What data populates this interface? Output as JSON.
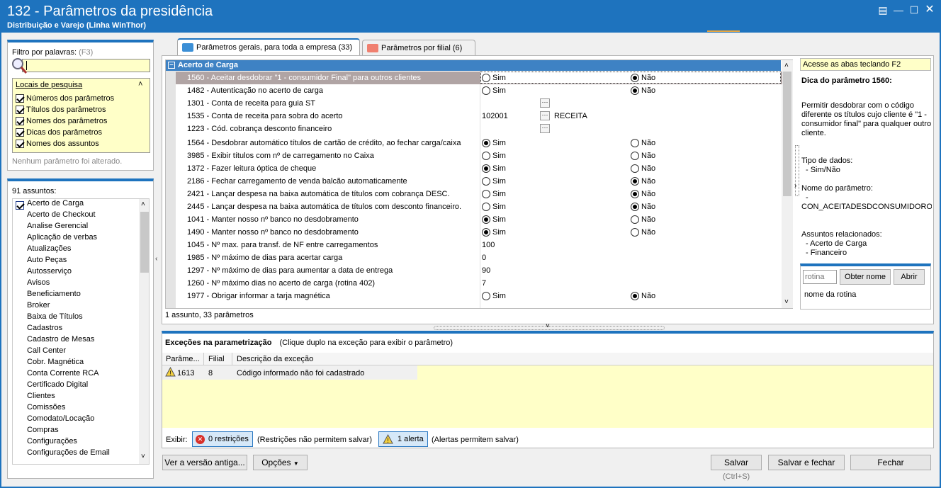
{
  "window": {
    "title": "132 - Parâmetros da presidência",
    "subtitle": "Distribuição e Varejo (Linha WinThor)"
  },
  "filter": {
    "label": "Filtro por palavras:",
    "shortcut": "(F3)",
    "search_value": "",
    "locais_title": "Locais de pesquisa",
    "locais": [
      "Números dos parâmetros",
      "Títulos dos parâmetros",
      "Nomes dos parâmetros",
      "Dicas dos parâmetros",
      "Nomes dos assuntos"
    ],
    "status": "Nenhum parâmetro foi alterado."
  },
  "subjects": {
    "count_label": "91 assuntos:",
    "items": [
      "Acerto de Carga",
      "Acerto de Checkout",
      "Analise Gerencial",
      "Aplicação de verbas",
      "Atualizações",
      "Auto Peças",
      "Autosserviço",
      "Avisos",
      "Beneficiamento",
      "Broker",
      "Baixa de Títulos",
      "Cadastros",
      "Cadastro de Mesas",
      "Call Center",
      "Cobr. Magnética",
      "Conta Corrente RCA",
      "Certificado Digital",
      "Clientes",
      "Comissões",
      "Comodato/Locação",
      "Compras",
      "Configurações",
      "Configurações de Email"
    ]
  },
  "tabs": [
    {
      "label": "Parâmetros gerais, para toda a empresa",
      "count": "(33)"
    },
    {
      "label": "Parâmetros por filial",
      "count": "(6)"
    }
  ],
  "grid": {
    "group_title": "Acerto de Carga",
    "rows": [
      {
        "label": "1560 - Aceitar desdobrar \"1 - consumidor Final\" para outros clientes",
        "kind": "radio",
        "opt1": "Sim",
        "opt2": "Não",
        "sel": 2
      },
      {
        "label": "1482 - Autenticação no acerto de carga",
        "kind": "radio",
        "opt1": "Sim",
        "opt2": "Não",
        "sel": 2
      },
      {
        "label": "1301 - Conta de receita para guia ST",
        "kind": "lookup",
        "value": "",
        "extra": ""
      },
      {
        "label": "1535 - Conta de receita para sobra do acerto",
        "kind": "lookup",
        "value": "102001",
        "extra": "RECEITA"
      },
      {
        "label": "1223 - Cód. cobrança desconto financeiro",
        "kind": "lookup",
        "value": "",
        "extra": ""
      },
      {
        "label": "1564 - Desdobrar automático títulos de cartão de crédito, ao fechar carga/caixa",
        "kind": "radio",
        "opt1": "Sim",
        "opt2": "Não",
        "sel": 1
      },
      {
        "label": "3985 - Exibir títulos com nº de carregamento no Caixa",
        "kind": "radio",
        "opt1": "Sim",
        "opt2": "Não",
        "sel": 0
      },
      {
        "label": "1372 - Fazer leitura óptica de cheque",
        "kind": "radio",
        "opt1": "Sim",
        "opt2": "Não",
        "sel": 1
      },
      {
        "label": "2186 - Fechar carregamento de venda balcão automaticamente",
        "kind": "radio",
        "opt1": "Sim",
        "opt2": "Não",
        "sel": 2
      },
      {
        "label": "2421 - Lançar despesa na baixa automática de títulos com cobrança DESC.",
        "kind": "radio",
        "opt1": "Sim",
        "opt2": "Não",
        "sel": 2
      },
      {
        "label": "2445 - Lançar despesa na baixa automática de títulos com desconto financeiro.",
        "kind": "radio",
        "opt1": "Sim",
        "opt2": "Não",
        "sel": 2
      },
      {
        "label": "1041 - Manter nosso nº banco no desdobramento",
        "kind": "radio",
        "opt1": "Sim",
        "opt2": "Não",
        "sel": 1
      },
      {
        "label": "1490 - Manter nosso nº banco no desdobramento",
        "kind": "radio",
        "opt1": "Sim",
        "opt2": "Não",
        "sel": 1
      },
      {
        "label": "1045 - Nº max. para transf. de NF entre carregamentos",
        "kind": "text",
        "value": "100"
      },
      {
        "label": "1985 - Nº máximo de dias para acertar carga",
        "kind": "text",
        "value": "0"
      },
      {
        "label": "1297 - Nº máximo de dias para aumentar a data de entrega",
        "kind": "text",
        "value": "90"
      },
      {
        "label": "1260 - Nº máximo dias no acerto de carga (rotina 402)",
        "kind": "text",
        "value": "7"
      },
      {
        "label": "1977 - Obrigar informar a tarja magnética",
        "kind": "radio",
        "opt1": "Sim",
        "opt2": "Não",
        "sel": 2
      }
    ],
    "footer": "1 assunto, 33 parâmetros"
  },
  "help": {
    "hint": "Acesse as abas teclando F2",
    "title": "Dica do parâmetro 1560:",
    "desc": "Permitir desdobrar com o código diferente os títulos cujo cliente é \"1 - consumidor final\" para qualquer outro cliente.",
    "tipo_label": "Tipo de dados:",
    "tipo_value": "- Sim/Não",
    "nome_label": "Nome do parâmetro:",
    "nome_dash": "-",
    "nome_value": "CON_ACEITADESDCONSUMIDOROUT",
    "assuntos_label": "Assuntos relacionados:",
    "assuntos": [
      "- Acerto de Carga",
      "- Financeiro"
    ],
    "rotina_placeholder": "rotina",
    "obter_label": "Obter nome",
    "abrir_label": "Abrir",
    "rotina_caption": "nome da rotina"
  },
  "exceptions": {
    "title": "Exceções na parametrização",
    "hint": "(Clique duplo na exceção para exibir o parâmetro)",
    "columns": [
      "Parâme...",
      "Filial",
      "Descrição da exceção"
    ],
    "rows": [
      {
        "param": "1613",
        "filial": "8",
        "desc": "Código informado não foi cadastrado"
      }
    ],
    "exibir_label": "Exibir:",
    "restr_button": "0 restrições",
    "restr_note": "(Restrições não permitem salvar)",
    "alert_button": "1 alerta",
    "alert_note": "(Alertas permitem salvar)"
  },
  "footer": {
    "old_version": "Ver a versão antiga...",
    "options": "Opções",
    "save": "Salvar",
    "save_shortcut": "(Ctrl+S)",
    "save_close": "Salvar e fechar",
    "close": "Fechar"
  }
}
